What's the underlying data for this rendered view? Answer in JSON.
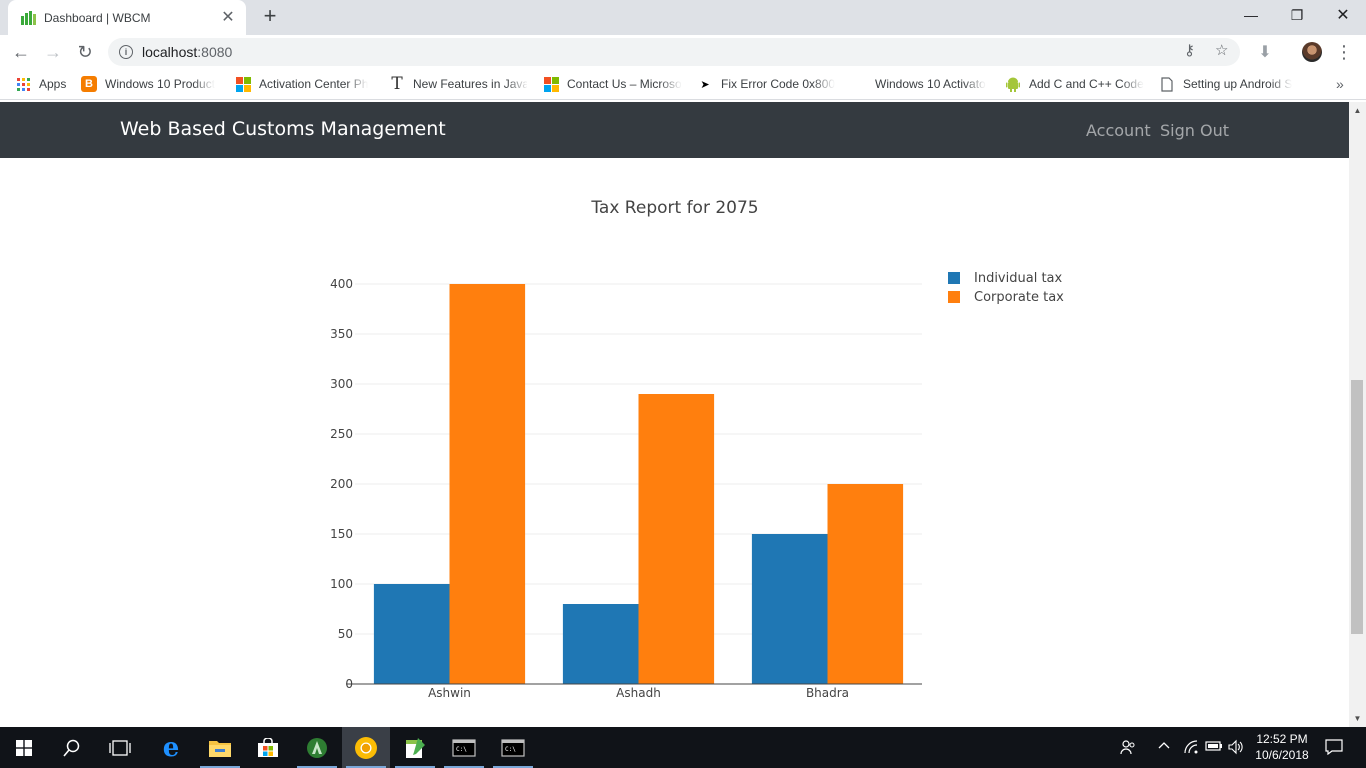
{
  "browser": {
    "tab_title": "Dashboard | WBCM",
    "url_host": "localhost",
    "url_port": ":8080",
    "bookmarks": [
      {
        "label": "Apps",
        "icon": "apps-grid-icon"
      },
      {
        "label": "Windows 10 Product",
        "icon": "blogger-icon"
      },
      {
        "label": "Activation Center Ph",
        "icon": "microsoft-icon"
      },
      {
        "label": "New Features in Java",
        "icon": "serif-t-icon"
      },
      {
        "label": "Contact Us – Microso",
        "icon": "microsoft-icon"
      },
      {
        "label": "Fix Error Code 0x800",
        "icon": "blank-icon"
      },
      {
        "label": "Windows 10 Activato",
        "icon": "blank-icon"
      },
      {
        "label": "Add C and C++ Code",
        "icon": "android-icon"
      },
      {
        "label": "Setting up Android S",
        "icon": "page-icon"
      }
    ]
  },
  "app": {
    "brand": "Web Based Customs Management",
    "nav": {
      "account": "Account",
      "sign_out": "Sign Out"
    }
  },
  "colors": {
    "individual": "#1f77b4",
    "corporate": "#ff7f0e",
    "navbar": "#343a40"
  },
  "chart_data": {
    "type": "bar",
    "title": "Tax Report for 2075",
    "categories": [
      "Ashwin",
      "Ashadh",
      "Bhadra"
    ],
    "series": [
      {
        "name": "Individual tax",
        "values": [
          100,
          80,
          150
        ]
      },
      {
        "name": "Corporate tax",
        "values": [
          400,
          290,
          200
        ]
      }
    ],
    "ylim": [
      0,
      400
    ],
    "yticks": [
      0,
      50,
      100,
      150,
      200,
      250,
      300,
      350,
      400
    ],
    "grid": true,
    "legend": "top-right"
  },
  "taskbar": {
    "time": "12:52 PM",
    "date": "10/6/2018"
  }
}
